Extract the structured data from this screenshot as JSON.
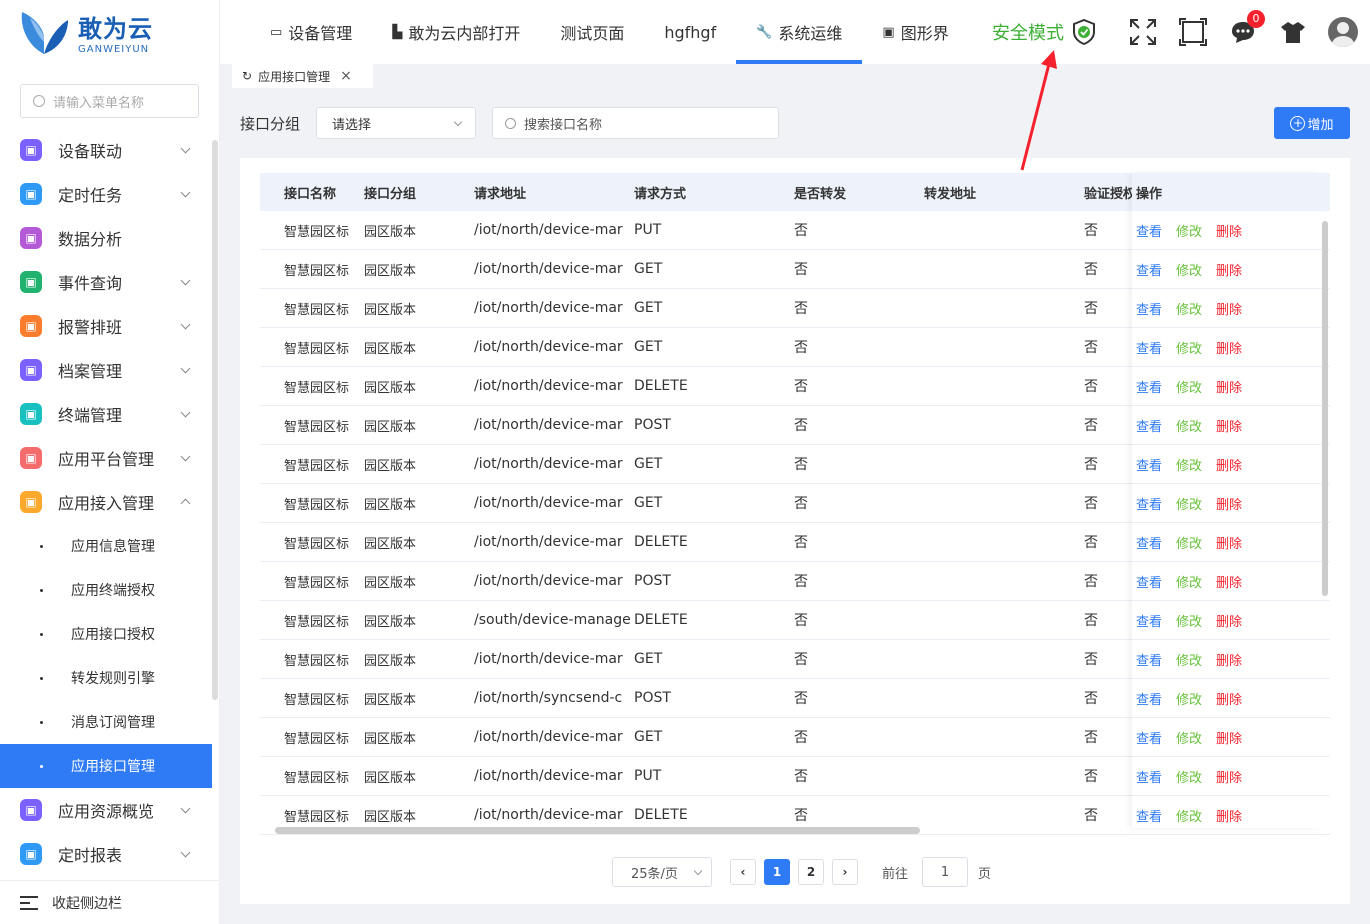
{
  "logo": {
    "cn": "敢为云",
    "en": "GANWEIYUN"
  },
  "sidebar": {
    "search_placeholder": "请输入菜单名称",
    "items": [
      {
        "label": "设备联动",
        "color": "#7b61ff",
        "expandable": true
      },
      {
        "label": "定时任务",
        "color": "#2f9af5",
        "expandable": true
      },
      {
        "label": "数据分析",
        "color": "#b45ad6",
        "expandable": false
      },
      {
        "label": "事件查询",
        "color": "#21b26f",
        "expandable": true
      },
      {
        "label": "报警排班",
        "color": "#fa7d2d",
        "expandable": true
      },
      {
        "label": "档案管理",
        "color": "#7b61ff",
        "expandable": true
      },
      {
        "label": "终端管理",
        "color": "#19c0c0",
        "expandable": true
      },
      {
        "label": "应用平台管理",
        "color": "#f56c6c",
        "expandable": true
      },
      {
        "label": "应用接入管理",
        "color": "#fba92c",
        "expandable": true
      }
    ],
    "sub_items": [
      "应用信息管理",
      "应用终端授权",
      "应用接口授权",
      "转发规则引擎",
      "消息订阅管理",
      "应用接口管理"
    ],
    "items_after": [
      {
        "label": "应用资源概览",
        "color": "#7b61ff"
      },
      {
        "label": "定时报表",
        "color": "#2f9af5"
      }
    ],
    "collapse_label": "收起侧边栏"
  },
  "header": {
    "tabs": [
      {
        "label": "设备管理",
        "icon": "monitor-icon"
      },
      {
        "label": "敢为云内部打开",
        "icon": "factory-icon"
      },
      {
        "label": "测试页面",
        "icon": ""
      },
      {
        "label": "hgfhgf",
        "icon": ""
      },
      {
        "label": "系统运维",
        "icon": "wrench-icon"
      },
      {
        "label": "图形界",
        "icon": "screen-icon"
      }
    ],
    "active_tab": 4,
    "safe_mode": "安全模式",
    "badge_count": "0"
  },
  "page_tab": {
    "label": "应用接口管理"
  },
  "filters": {
    "group_label": "接口分组",
    "group_placeholder": "请选择",
    "search_placeholder": "搜索接口名称",
    "add_label": "增加"
  },
  "table": {
    "columns": [
      "接口名称",
      "接口分组",
      "请求地址",
      "请求方式",
      "是否转发",
      "转发地址",
      "验证授权",
      "操作"
    ],
    "ops": {
      "view": "查看",
      "edit": "修改",
      "del": "删除"
    },
    "rows": [
      [
        "智慧园区标",
        "园区版本",
        "/iot/north/device-mar",
        "PUT",
        "否",
        "",
        "否"
      ],
      [
        "智慧园区标",
        "园区版本",
        "/iot/north/device-mar",
        "GET",
        "否",
        "",
        "否"
      ],
      [
        "智慧园区标",
        "园区版本",
        "/iot/north/device-mar",
        "GET",
        "否",
        "",
        "否"
      ],
      [
        "智慧园区标",
        "园区版本",
        "/iot/north/device-mar",
        "GET",
        "否",
        "",
        "否"
      ],
      [
        "智慧园区标",
        "园区版本",
        "/iot/north/device-mar",
        "DELETE",
        "否",
        "",
        "否"
      ],
      [
        "智慧园区标",
        "园区版本",
        "/iot/north/device-mar",
        "POST",
        "否",
        "",
        "否"
      ],
      [
        "智慧园区标",
        "园区版本",
        "/iot/north/device-mar",
        "GET",
        "否",
        "",
        "否"
      ],
      [
        "智慧园区标",
        "园区版本",
        "/iot/north/device-mar",
        "GET",
        "否",
        "",
        "否"
      ],
      [
        "智慧园区标",
        "园区版本",
        "/iot/north/device-mar",
        "DELETE",
        "否",
        "",
        "否"
      ],
      [
        "智慧园区标",
        "园区版本",
        "/iot/north/device-mar",
        "POST",
        "否",
        "",
        "否"
      ],
      [
        "智慧园区标",
        "园区版本",
        "/south/device-manage",
        "DELETE",
        "否",
        "",
        "否"
      ],
      [
        "智慧园区标",
        "园区版本",
        "/iot/north/device-mar",
        "GET",
        "否",
        "",
        "否"
      ],
      [
        "智慧园区标",
        "园区版本",
        "/iot/north/syncsend-c",
        "POST",
        "否",
        "",
        "否"
      ],
      [
        "智慧园区标",
        "园区版本",
        "/iot/north/device-mar",
        "GET",
        "否",
        "",
        "否"
      ],
      [
        "智慧园区标",
        "园区版本",
        "/iot/north/device-mar",
        "PUT",
        "否",
        "",
        "否"
      ],
      [
        "智慧园区标",
        "园区版本",
        "/iot/north/device-mar",
        "DELETE",
        "否",
        "",
        "否"
      ]
    ]
  },
  "pager": {
    "size": "25条/页",
    "pages": [
      "1",
      "2"
    ],
    "current": "1",
    "goto_label": "前往",
    "goto_value": "1",
    "page_unit": "页"
  }
}
